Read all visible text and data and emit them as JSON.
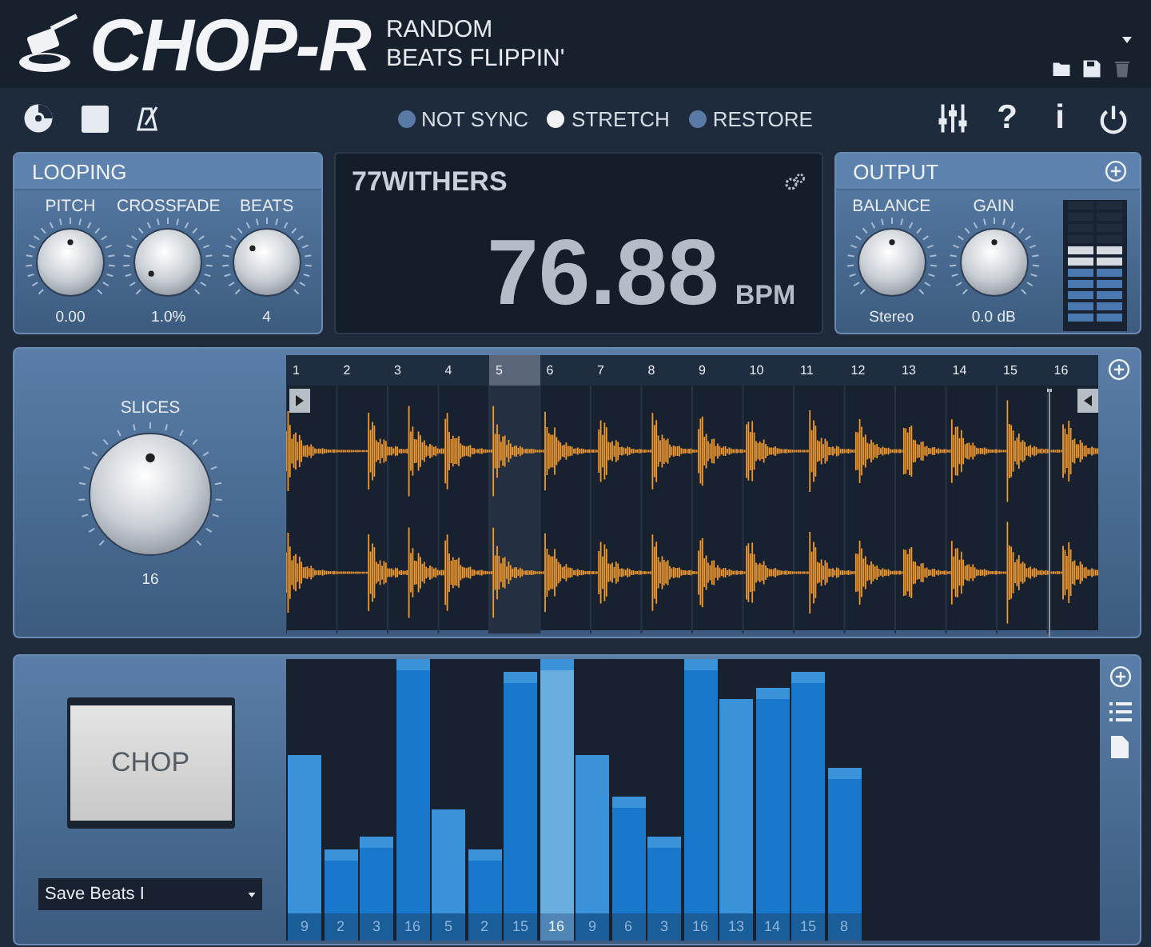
{
  "header": {
    "logo": "CHOP-R",
    "subtitle_lines": [
      "RANDOM",
      "BEATS FLIPPIN'"
    ],
    "actions": [
      {
        "kind": "folder",
        "disabled": false
      },
      {
        "kind": "save",
        "disabled": false
      },
      {
        "kind": "trash",
        "disabled": true
      }
    ]
  },
  "toolbar": {
    "left_tools": [
      {
        "kind": "disc"
      },
      {
        "kind": "stop"
      },
      {
        "kind": "metronome"
      }
    ],
    "modes": [
      {
        "label": "NOT SYNC",
        "selected": false
      },
      {
        "label": "STRETCH",
        "selected": true
      },
      {
        "label": "RESTORE",
        "selected": false
      }
    ],
    "right_tools": [
      {
        "kind": "mixer"
      },
      {
        "kind": "text",
        "label": "?"
      },
      {
        "kind": "text",
        "label": "i"
      },
      {
        "kind": "power"
      }
    ]
  },
  "looping": {
    "title": "LOOPING",
    "knobs": [
      {
        "label": "PITCH",
        "value": "0.00"
      },
      {
        "label": "CROSSFADE",
        "value": "1.0%"
      },
      {
        "label": "BEATS",
        "value": "4"
      }
    ]
  },
  "display": {
    "sample_name": "77WITHERS",
    "tempo": "76.88",
    "unit": "BPM"
  },
  "output": {
    "title": "OUTPUT",
    "knobs": [
      {
        "label": "BALANCE",
        "value": "Stereo"
      },
      {
        "label": "GAIN",
        "value": "0.0 dB"
      }
    ]
  },
  "slicer": {
    "knob": {
      "label": "SLICES",
      "value": "16"
    },
    "slices": [
      {
        "label": "1",
        "selected": false
      },
      {
        "label": "2",
        "selected": false
      },
      {
        "label": "3",
        "selected": false
      },
      {
        "label": "4",
        "selected": false
      },
      {
        "label": "5",
        "selected": true
      },
      {
        "label": "6",
        "selected": false
      },
      {
        "label": "7",
        "selected": false
      },
      {
        "label": "8",
        "selected": false
      },
      {
        "label": "9",
        "selected": false
      },
      {
        "label": "10",
        "selected": false
      },
      {
        "label": "11",
        "selected": false
      },
      {
        "label": "12",
        "selected": false
      },
      {
        "label": "13",
        "selected": false
      },
      {
        "label": "14",
        "selected": false
      },
      {
        "label": "15",
        "selected": false
      },
      {
        "label": "16",
        "selected": false
      }
    ]
  },
  "sequencer": {
    "chop_button": "CHOP",
    "preset": "Save Beats I",
    "steps": [
      {
        "slice": "9",
        "color": "#3a93d8",
        "selected": false
      },
      {
        "slice": "2",
        "color": "#1a78cc",
        "selected": false
      },
      {
        "slice": "3",
        "color": "#1a78cc",
        "selected": false
      },
      {
        "slice": "16",
        "color": "#1a78cc",
        "selected": false
      },
      {
        "slice": "5",
        "color": "#3a93d8",
        "selected": false
      },
      {
        "slice": "2",
        "color": "#1a78cc",
        "selected": false
      },
      {
        "slice": "15",
        "color": "#1a78cc",
        "selected": false
      },
      {
        "slice": "16",
        "color": "#6aaee0",
        "selected": true
      },
      {
        "slice": "9",
        "color": "#3a93d8",
        "selected": false
      },
      {
        "slice": "6",
        "color": "#1a78cc",
        "selected": false
      },
      {
        "slice": "3",
        "color": "#1a78cc",
        "selected": false
      },
      {
        "slice": "16",
        "color": "#1a78cc",
        "selected": false
      },
      {
        "slice": "13",
        "color": "#3a93d8",
        "selected": false
      },
      {
        "slice": "14",
        "color": "#1a78cc",
        "selected": false
      },
      {
        "slice": "15",
        "color": "#1a78cc",
        "selected": false
      },
      {
        "slice": "8",
        "color": "#1a78cc",
        "selected": false
      }
    ]
  }
}
